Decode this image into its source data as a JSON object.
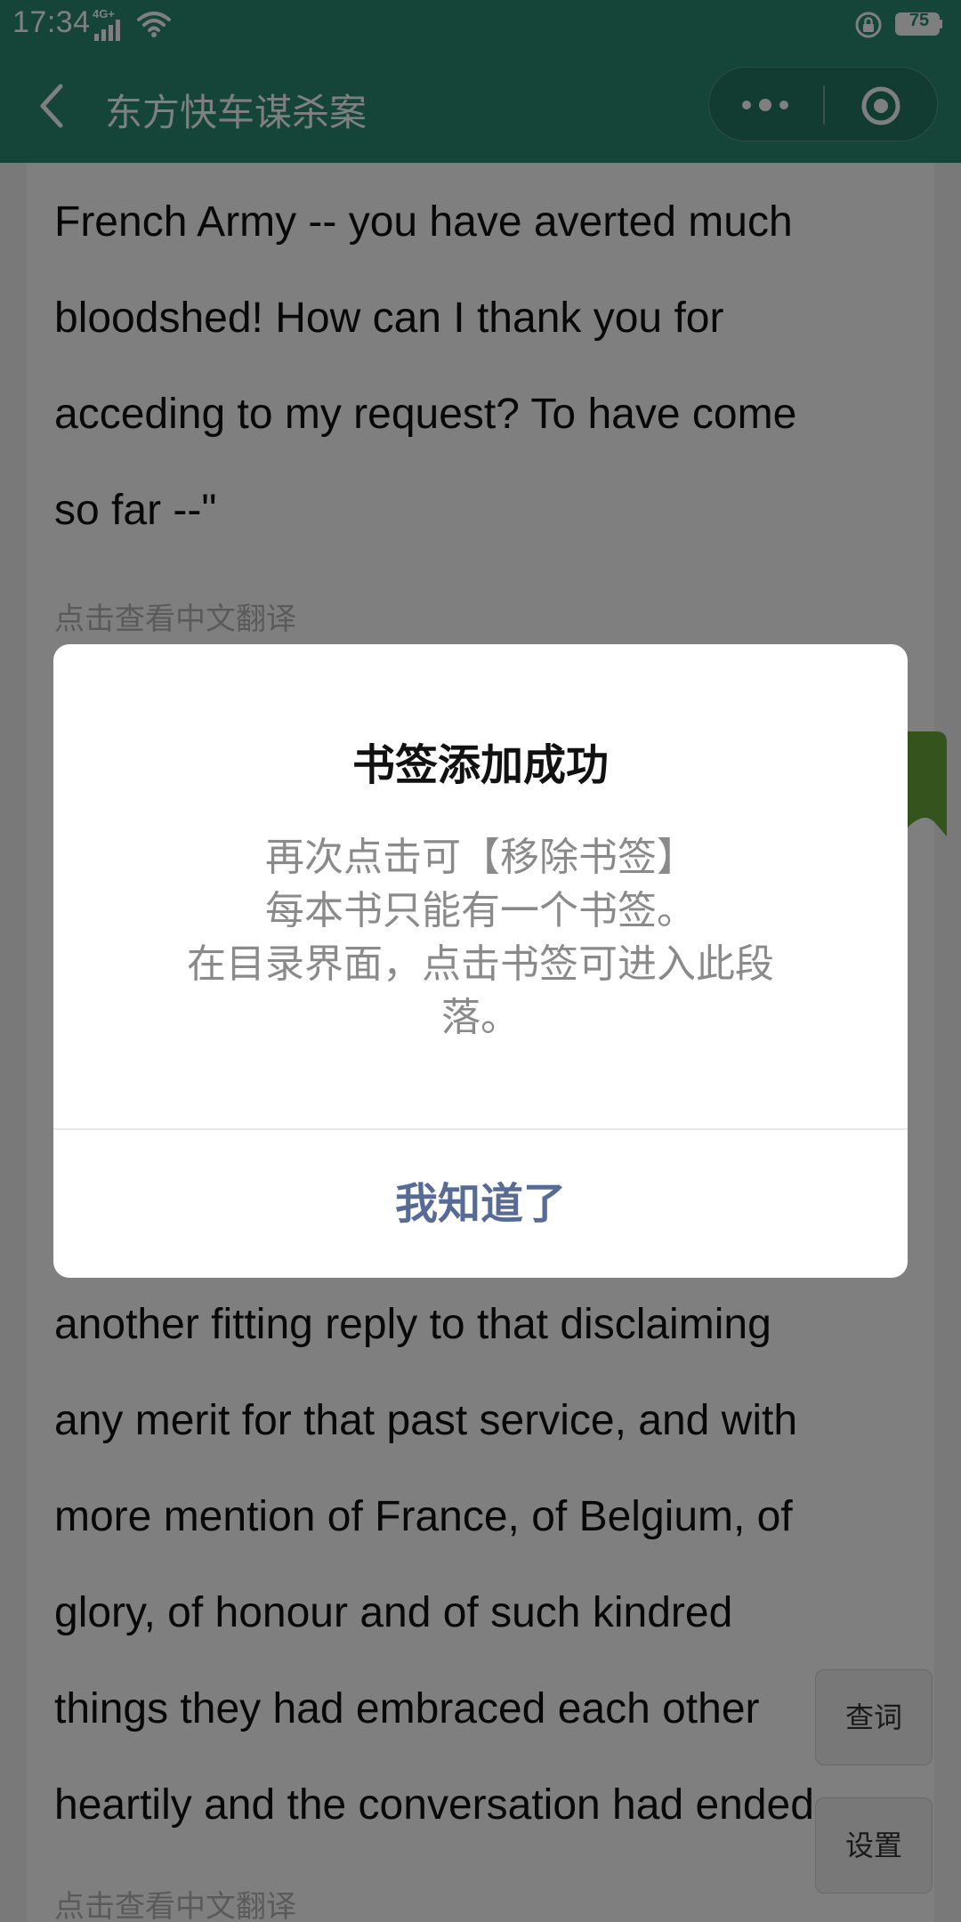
{
  "status_bar": {
    "time": "17:34",
    "network": "4G+",
    "battery": "75"
  },
  "header": {
    "title": "东方快车谋杀案"
  },
  "reader": {
    "paragraphs": [
      {
        "lines": [
          "French Army -- you have averted much",
          "bloodshed! How can I thank you for",
          "acceding to my request? To have come",
          "so far --\""
        ],
        "translate_link": "点击查看中文翻译"
      },
      {
        "lines": [
          "another fitting reply to that disclaiming",
          "any merit for that past service, and with",
          "more mention of France, of Belgium, of",
          "glory, of honour and of such kindred",
          "things they had embraced each other",
          "heartily and the conversation had ended."
        ],
        "translate_link": "点击查看中文翻译"
      }
    ]
  },
  "floating_buttons": {
    "lookup": "查词",
    "settings": "设置"
  },
  "modal": {
    "title": "书签添加成功",
    "body_lines": [
      "再次点击可【移除书签】",
      "每本书只能有一个书签。",
      "在目录界面，点击书签可进入此段",
      "落。"
    ],
    "confirm": "我知道了"
  },
  "colors": {
    "header_bg": "#2a8a70",
    "bookmark_green": "#6aa63a",
    "modal_confirm": "#576b95"
  }
}
